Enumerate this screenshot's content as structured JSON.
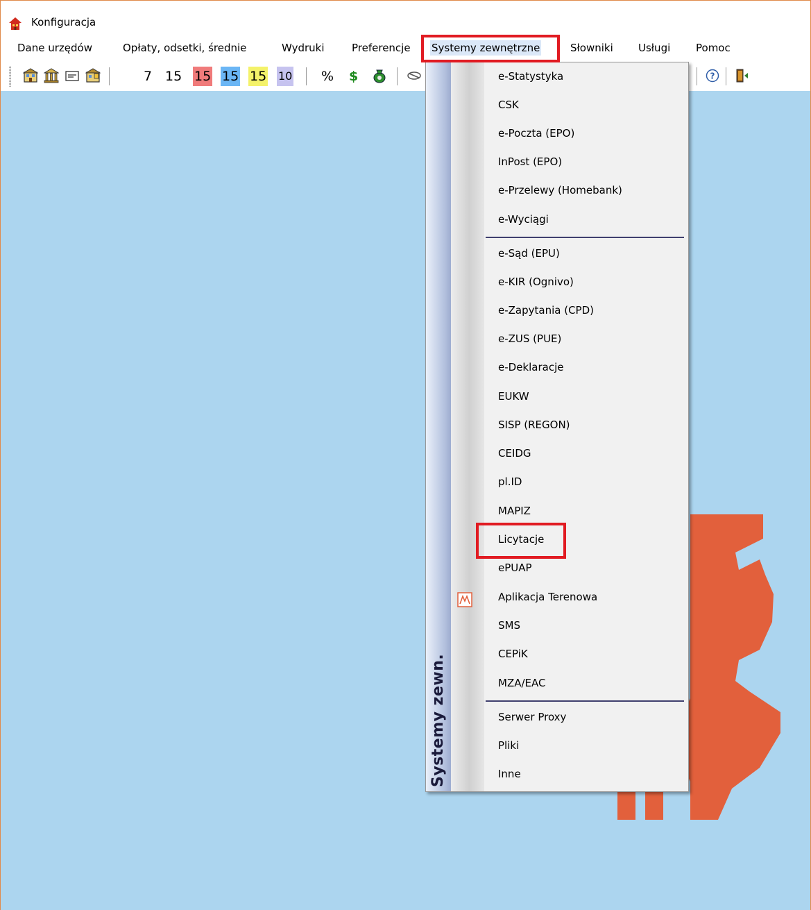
{
  "window": {
    "title": "Konfiguracja"
  },
  "menubar": {
    "items": [
      {
        "label": "Dane urzędów"
      },
      {
        "label": "Opłaty, odsetki, średnie"
      },
      {
        "label": "Wydruki"
      },
      {
        "label": "Preferencje"
      },
      {
        "label": "Systemy zewnętrzne"
      },
      {
        "label": "Słowniki"
      },
      {
        "label": "Usługi"
      },
      {
        "label": "Pomoc"
      }
    ],
    "active": "Systemy zewnętrzne"
  },
  "toolbar": {
    "numbers": [
      {
        "label": "7",
        "bg": ""
      },
      {
        "label": "15",
        "bg": ""
      },
      {
        "label": "15",
        "bg": "#f07b7b"
      },
      {
        "label": "15",
        "bg": "#6bb6f5"
      },
      {
        "label": "15",
        "bg": "#f4f26a"
      },
      {
        "label": "10",
        "bg": "#c6c3ef"
      }
    ],
    "percent": "%",
    "dollar": "$",
    "icons": [
      "office-icon",
      "bank-icon",
      "card-icon",
      "building-icon",
      "money-bag-icon",
      "plug-icon",
      "help-icon",
      "exit-door-icon"
    ]
  },
  "dropdown": {
    "side_label": "Systemy zewn.",
    "groups": [
      {
        "items": [
          "e-Statystyka",
          "CSK",
          "e-Poczta (EPO)",
          "InPost (EPO)",
          "e-Przelewy (Homebank)",
          "e-Wyciągi"
        ]
      },
      {
        "items": [
          "e-Sąd (EPU)",
          "e-KIR (Ognivo)",
          "e-Zapytania (CPD)",
          "e-ZUS (PUE)",
          "e-Deklaracje",
          "EUKW",
          "SISP (REGON)",
          "CEIDG",
          "pl.ID",
          "MAPIZ",
          "Licytacje",
          "ePUAP",
          "Aplikacja Terenowa",
          "SMS",
          "CEPiK",
          "MZA/EAC"
        ]
      },
      {
        "items": [
          "Serwer Proxy",
          "Pliki",
          "Inne"
        ]
      }
    ],
    "highlighted_item": "Licytacje",
    "item_with_icon": "Aplikacja Terenowa"
  },
  "colors": {
    "desktop_bg": "#acd5ef",
    "highlight_border": "#e11b22",
    "logo": "#e2603c"
  }
}
